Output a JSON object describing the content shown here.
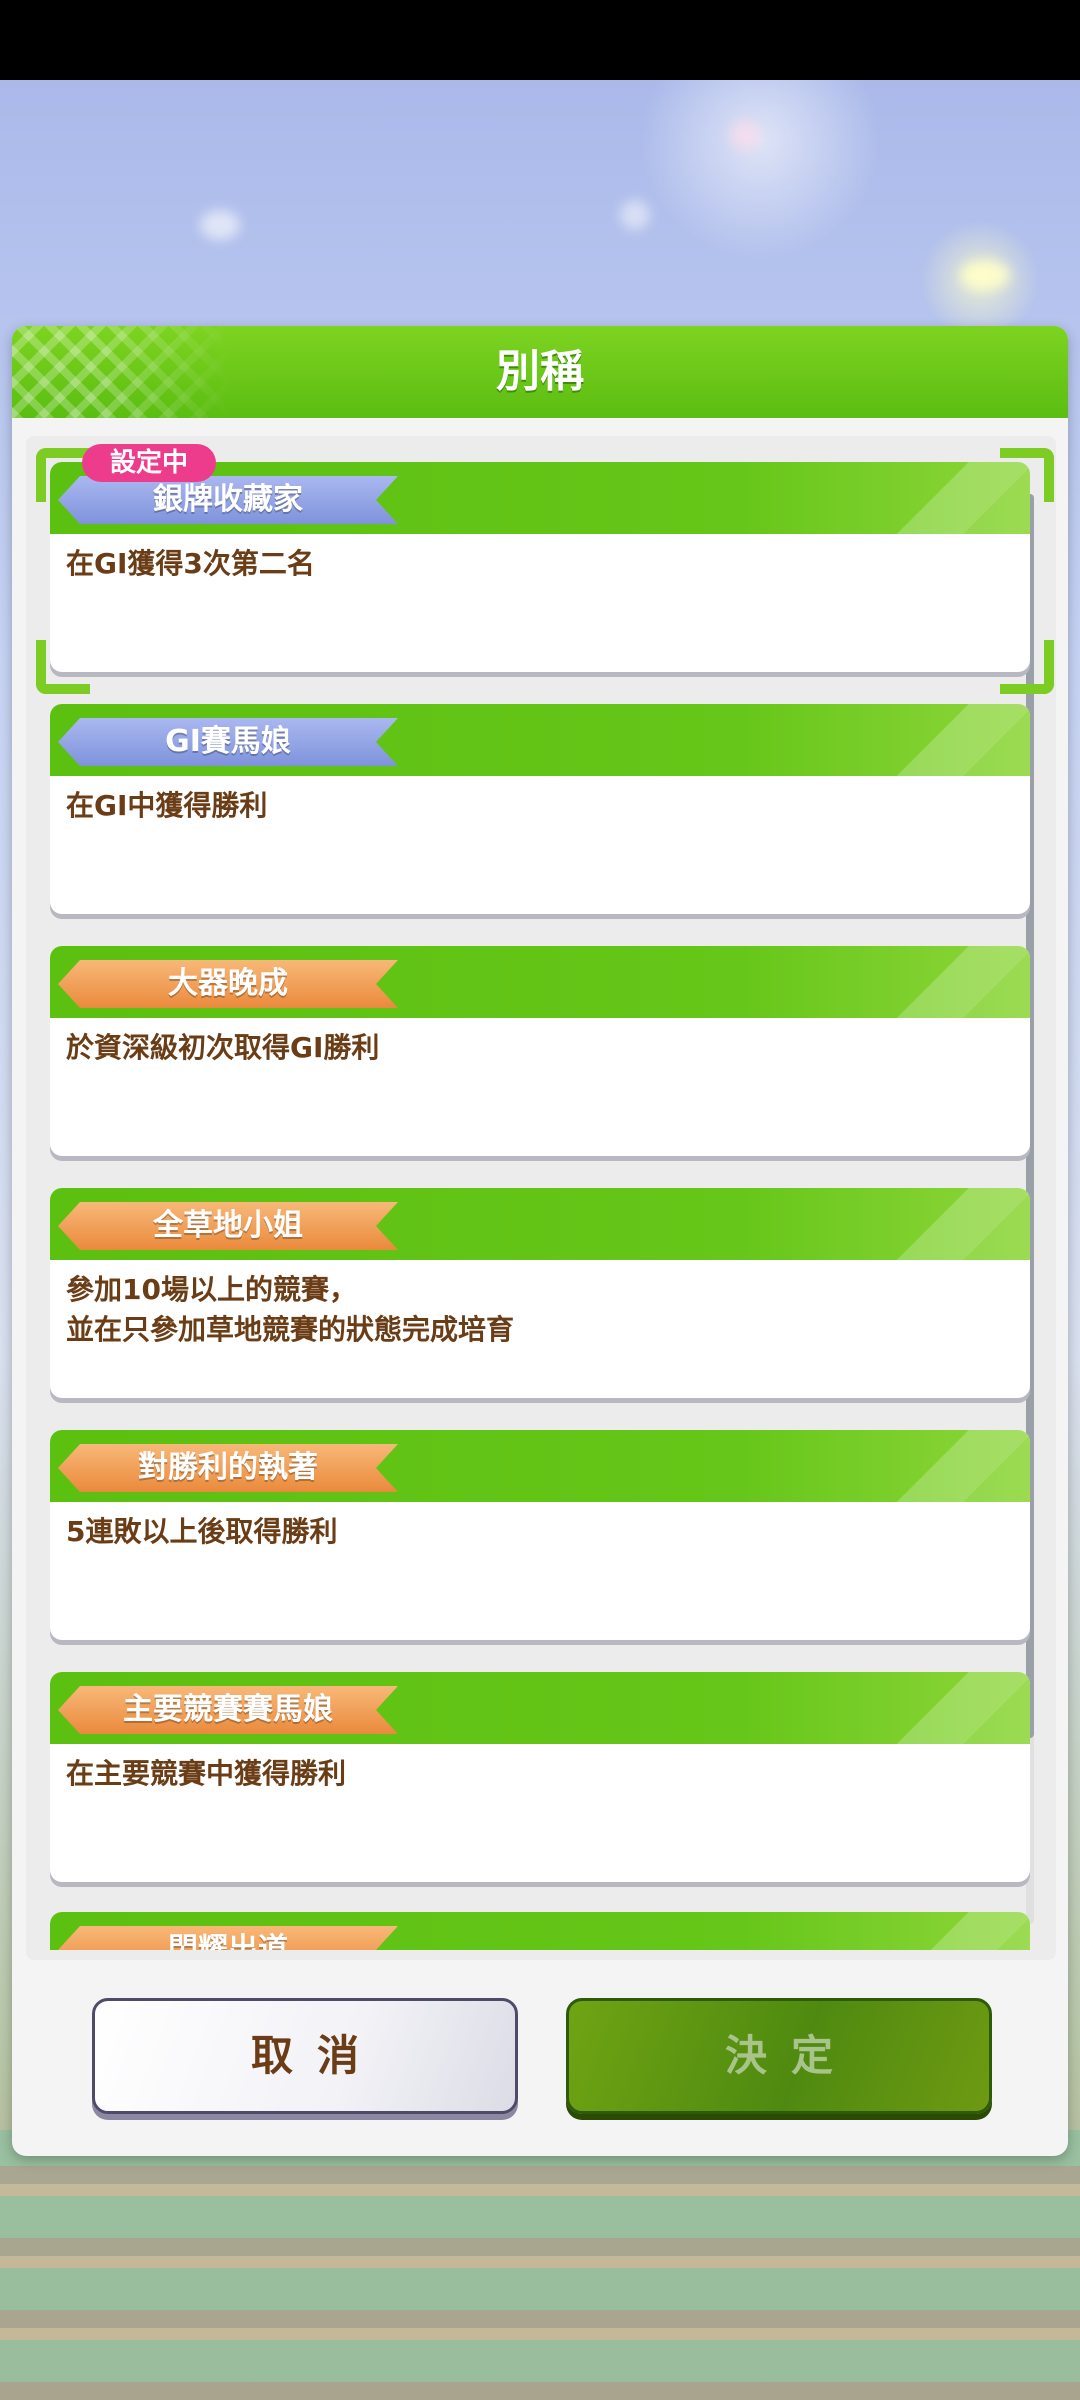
{
  "dialog": {
    "title": "別稱"
  },
  "current_badge": "設定中",
  "titles": [
    {
      "name": "銀牌收藏家",
      "ribbon_color": "#8fa2e6",
      "description": "在GⅠ獲得3次第二名"
    },
    {
      "name": "GⅠ賽馬娘",
      "ribbon_color": "#8fa2e6",
      "description": "在GⅠ中獲得勝利"
    },
    {
      "name": "大器晚成",
      "ribbon_color": "#ef9a50",
      "description": "於資深級初次取得GⅠ勝利"
    },
    {
      "name": "全草地小姐",
      "ribbon_color": "#ef9a50",
      "description": "參加10場以上的競賽，\n並在只參加草地競賽的狀態完成培育"
    },
    {
      "name": "對勝利的執著",
      "ribbon_color": "#ef9a50",
      "description": "5連敗以上後取得勝利"
    },
    {
      "name": "主要競賽賽馬娘",
      "ribbon_color": "#ef9a50",
      "description": "在主要競賽中獲得勝利"
    },
    {
      "name": "閃耀出道",
      "ribbon_color": "#ef9a50",
      "description": ""
    }
  ],
  "buttons": {
    "cancel": "取消",
    "confirm": "決定"
  },
  "colors": {
    "header_green": "#6cc618",
    "badge_pink": "#ee3c8c",
    "text_brown": "#6b3d16"
  }
}
